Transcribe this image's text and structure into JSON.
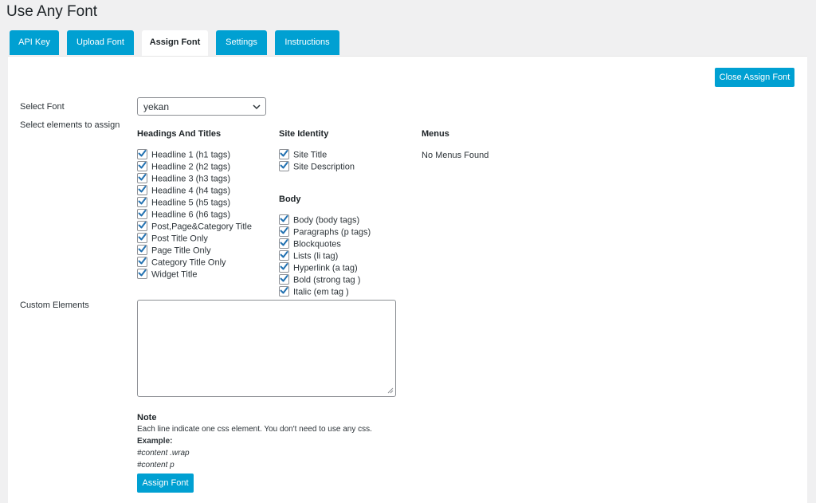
{
  "page": {
    "title": "Use Any Font"
  },
  "tabs": [
    {
      "label": "API Key",
      "active": false
    },
    {
      "label": "Upload Font",
      "active": false
    },
    {
      "label": "Assign Font",
      "active": true
    },
    {
      "label": "Settings",
      "active": false
    },
    {
      "label": "Instructions",
      "active": false
    }
  ],
  "header_actions": {
    "close_label": "Close Assign Font"
  },
  "form": {
    "select_font_label": "Select Font",
    "select_font_value": "yekan",
    "select_elements_label": "Select elements to assign",
    "custom_elements_label": "Custom Elements",
    "custom_elements_value": ""
  },
  "headings_group": {
    "title": "Headings And Titles",
    "items": [
      {
        "label": "Headline 1 (h1 tags)",
        "checked": true
      },
      {
        "label": "Headline 2 (h2 tags)",
        "checked": true
      },
      {
        "label": "Headline 3 (h3 tags)",
        "checked": true
      },
      {
        "label": "Headline 4 (h4 tags)",
        "checked": true
      },
      {
        "label": "Headline 5 (h5 tags)",
        "checked": true
      },
      {
        "label": "Headline 6 (h6 tags)",
        "checked": true
      },
      {
        "label": "Post,Page&Category Title",
        "checked": true
      },
      {
        "label": "Post Title Only",
        "checked": true
      },
      {
        "label": "Page Title Only",
        "checked": true
      },
      {
        "label": "Category Title Only",
        "checked": true
      },
      {
        "label": "Widget Title",
        "checked": true
      }
    ]
  },
  "site_identity_group": {
    "title": "Site Identity",
    "items": [
      {
        "label": "Site Title",
        "checked": true
      },
      {
        "label": "Site Description",
        "checked": true
      }
    ]
  },
  "body_group": {
    "title": "Body",
    "items": [
      {
        "label": "Body (body tags)",
        "checked": true
      },
      {
        "label": "Paragraphs (p tags)",
        "checked": true
      },
      {
        "label": "Blockquotes",
        "checked": true
      },
      {
        "label": "Lists (li tag)",
        "checked": true
      },
      {
        "label": "Hyperlink (a tag)",
        "checked": true
      },
      {
        "label": "Bold (strong tag )",
        "checked": true
      },
      {
        "label": "Italic (em tag )",
        "checked": true
      }
    ]
  },
  "menus_group": {
    "title": "Menus",
    "empty_text": "No Menus Found"
  },
  "note": {
    "title": "Note",
    "text": "Each line indicate one css element. You don't need to use any css.",
    "example_label": "Example:",
    "example_1": "#content .wrap",
    "example_2": "#content p"
  },
  "footer_actions": {
    "assign_label": "Assign Font"
  },
  "colors": {
    "accent": "#00a0d2",
    "check": "#2271b1",
    "background": "#f0f0f1"
  }
}
